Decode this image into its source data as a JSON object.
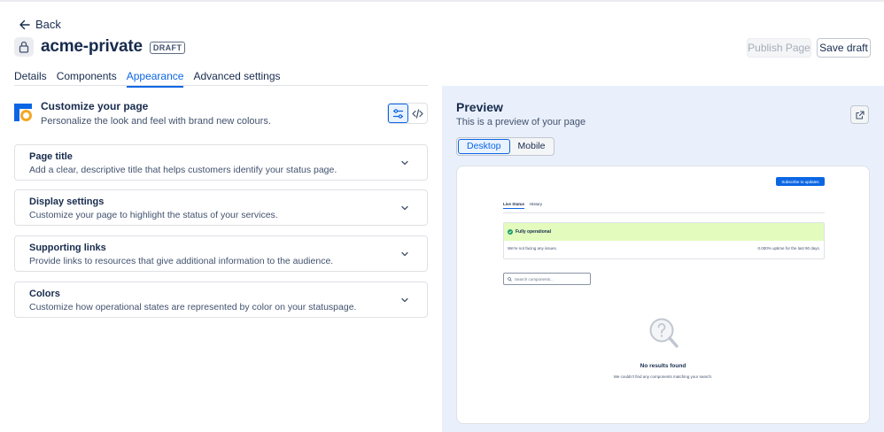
{
  "header": {
    "back_label": "Back",
    "page_name": "acme-private",
    "badge": "DRAFT",
    "publish_label": "Publish Page",
    "save_label": "Save draft"
  },
  "tabs": [
    {
      "label": "Details",
      "active": false
    },
    {
      "label": "Components",
      "active": false
    },
    {
      "label": "Appearance",
      "active": true
    },
    {
      "label": "Advanced settings",
      "active": false
    }
  ],
  "customize": {
    "title": "Customize your page",
    "subtitle": "Personalize the look and feel with brand new colours.",
    "view_modes": [
      "settings-sliders-icon",
      "code-icon"
    ],
    "active_view": "settings-sliders-icon"
  },
  "sections": [
    {
      "title": "Page title",
      "desc": "Add a clear, descriptive title that helps customers identify your status page."
    },
    {
      "title": "Display settings",
      "desc": "Customize your page to highlight the status of your services."
    },
    {
      "title": "Supporting links",
      "desc": "Provide links to resources that give additional information to the audience."
    },
    {
      "title": "Colors",
      "desc": "Customize how operational states are represented by color on your statuspage."
    }
  ],
  "preview": {
    "title": "Preview",
    "subtitle": "This is a preview of your page",
    "devices": [
      {
        "label": "Desktop",
        "active": true
      },
      {
        "label": "Mobile",
        "active": false
      }
    ],
    "page": {
      "subscribe_label": "Subscribe to updates",
      "tabs": [
        {
          "label": "Live Status",
          "active": true
        },
        {
          "label": "History",
          "active": false
        }
      ],
      "status_title": "Fully operational",
      "status_message": "We're not facing any issues.",
      "uptime": "0.000% uptime for the last 90 days.",
      "search_placeholder": "Search components...",
      "empty_title": "No results found",
      "empty_sub": "We couldn't find any components matching your search."
    }
  },
  "colors": {
    "accent": "#0c66e4",
    "operational_bg": "#e3fcbe",
    "operational_dot": "#22a06b",
    "preview_bg": "#e9f0fb"
  }
}
